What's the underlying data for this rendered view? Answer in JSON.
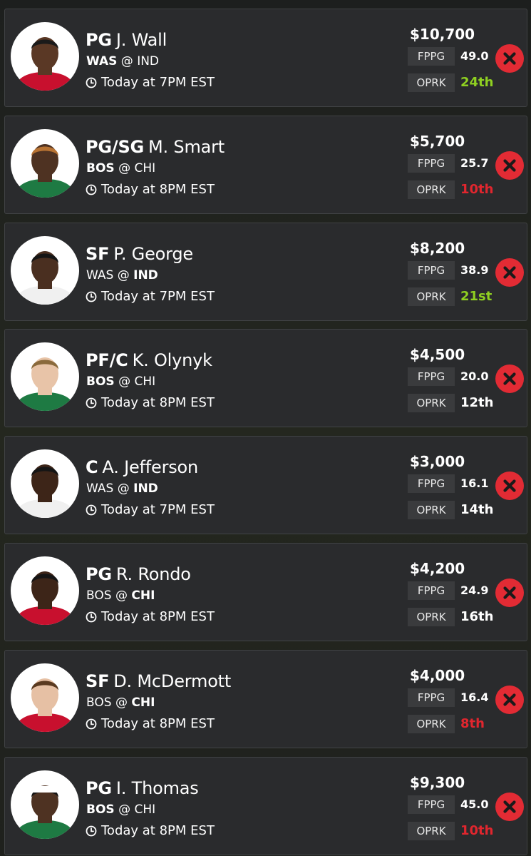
{
  "colors": {
    "green": "#8fd021",
    "red": "#e0262e",
    "white": "#ffffff",
    "remove": "#e22b34"
  },
  "labels": {
    "fppg": "FPPG",
    "oprk": "OPRK"
  },
  "players": [
    {
      "pos": "PG",
      "name": "J. Wall",
      "away": "WAS",
      "at": "@",
      "home": "IND",
      "bold": "away",
      "time": "Today at 7PM EST",
      "salary": "$10,700",
      "fppg": "49.0",
      "oprk": "24th",
      "oprk_color": "green",
      "jersey": "#c8102e",
      "skin": "#5a3825",
      "hair": "#1a1a1a",
      "headband": false
    },
    {
      "pos": "PG/SG",
      "name": "M. Smart",
      "away": "BOS",
      "at": "@",
      "home": "CHI",
      "bold": "away",
      "time": "Today at 8PM EST",
      "salary": "$5,700",
      "fppg": "25.7",
      "oprk": "10th",
      "oprk_color": "red",
      "jersey": "#1e7a43",
      "skin": "#4e3222",
      "hair": "#b87333",
      "headband": false
    },
    {
      "pos": "SF",
      "name": "P. George",
      "away": "WAS",
      "at": "@",
      "home": "IND",
      "bold": "home",
      "time": "Today at 7PM EST",
      "salary": "$8,200",
      "fppg": "38.9",
      "oprk": "21st",
      "oprk_color": "green",
      "jersey": "#f0f0f0",
      "skin": "#4a2f20",
      "hair": "#151515",
      "headband": false
    },
    {
      "pos": "PF/C",
      "name": "K. Olynyk",
      "away": "BOS",
      "at": "@",
      "home": "CHI",
      "bold": "away",
      "time": "Today at 8PM EST",
      "salary": "$4,500",
      "fppg": "20.0",
      "oprk": "12th",
      "oprk_color": "white",
      "jersey": "#1e7a43",
      "skin": "#e8c4a8",
      "hair": "#8a6a3c",
      "headband": false
    },
    {
      "pos": "C",
      "name": "A. Jefferson",
      "away": "WAS",
      "at": "@",
      "home": "IND",
      "bold": "home",
      "time": "Today at 7PM EST",
      "salary": "$3,000",
      "fppg": "16.1",
      "oprk": "14th",
      "oprk_color": "white",
      "jersey": "#f0f0f0",
      "skin": "#3d2518",
      "hair": "#151515",
      "headband": false
    },
    {
      "pos": "PG",
      "name": "R. Rondo",
      "away": "BOS",
      "at": "@",
      "home": "CHI",
      "bold": "home",
      "time": "Today at 8PM EST",
      "salary": "$4,200",
      "fppg": "24.9",
      "oprk": "16th",
      "oprk_color": "white",
      "jersey": "#c8102e",
      "skin": "#3d2518",
      "hair": "#151515",
      "headband": false
    },
    {
      "pos": "SF",
      "name": "D. McDermott",
      "away": "BOS",
      "at": "@",
      "home": "CHI",
      "bold": "home",
      "time": "Today at 8PM EST",
      "salary": "$4,000",
      "fppg": "16.4",
      "oprk": "8th",
      "oprk_color": "red",
      "jersey": "#c8102e",
      "skin": "#e6c0a4",
      "hair": "#5a3a20",
      "headband": false
    },
    {
      "pos": "PG",
      "name": "I. Thomas",
      "away": "BOS",
      "at": "@",
      "home": "CHI",
      "bold": "away",
      "time": "Today at 8PM EST",
      "salary": "$9,300",
      "fppg": "45.0",
      "oprk": "10th",
      "oprk_color": "red",
      "jersey": "#1e7a43",
      "skin": "#4e3222",
      "hair": "#151515",
      "headband": true
    }
  ]
}
